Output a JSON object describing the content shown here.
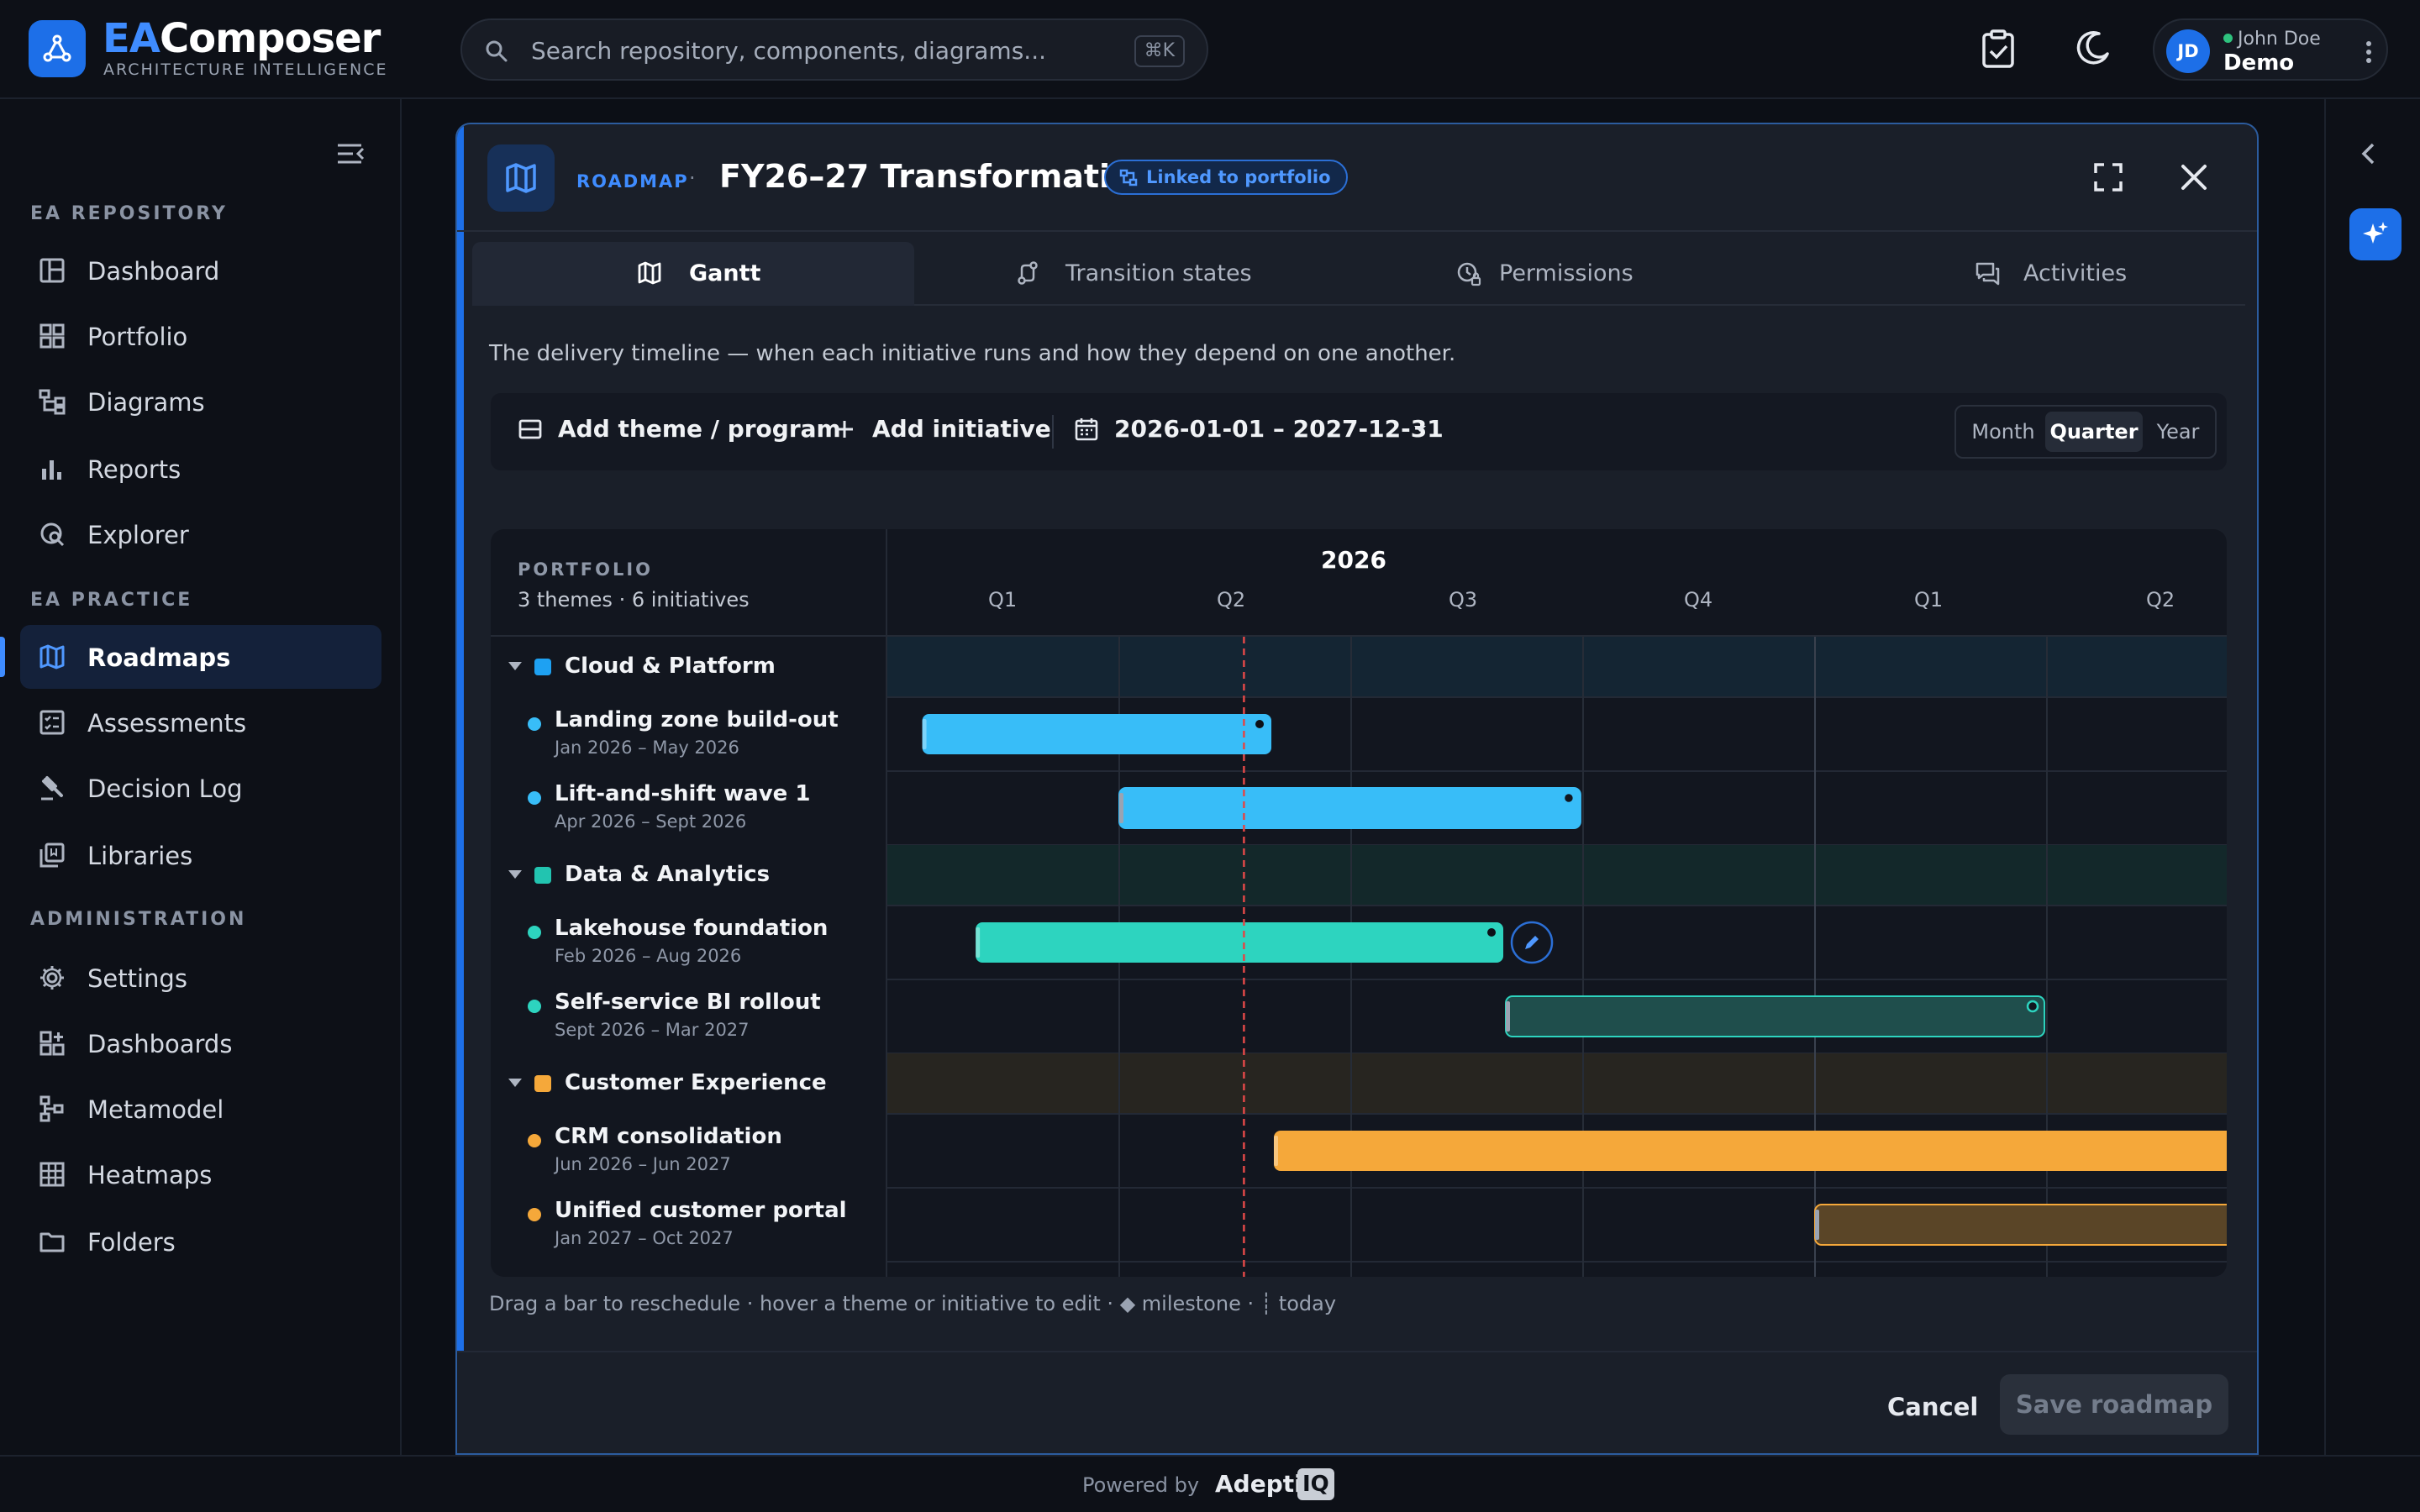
{
  "app": {
    "title_a": "EA",
    "title_b": "Composer",
    "subtitle": "ARCHITECTURE INTELLIGENCE"
  },
  "search": {
    "placeholder": "Search repository, components, diagrams...",
    "shortcut": "⌘K"
  },
  "user": {
    "initials": "JD",
    "name": "John Doe",
    "role": "Demo"
  },
  "sidebar": {
    "sections": [
      {
        "label": "EA REPOSITORY",
        "items": [
          {
            "label": "Dashboard",
            "icon": "dashboard-icon"
          },
          {
            "label": "Portfolio",
            "icon": "portfolio-icon"
          },
          {
            "label": "Diagrams",
            "icon": "diagrams-icon"
          },
          {
            "label": "Reports",
            "icon": "reports-icon"
          },
          {
            "label": "Explorer",
            "icon": "explorer-icon"
          }
        ]
      },
      {
        "label": "EA PRACTICE",
        "items": [
          {
            "label": "Roadmaps",
            "icon": "roadmaps-icon",
            "active": true
          },
          {
            "label": "Assessments",
            "icon": "assessments-icon"
          },
          {
            "label": "Decision Log",
            "icon": "gavel-icon"
          },
          {
            "label": "Libraries",
            "icon": "libraries-icon"
          }
        ]
      },
      {
        "label": "ADMINISTRATION",
        "items": [
          {
            "label": "Settings",
            "icon": "gear-icon"
          },
          {
            "label": "Dashboards",
            "icon": "dashboards-icon"
          },
          {
            "label": "Metamodel",
            "icon": "metamodel-icon"
          },
          {
            "label": "Heatmaps",
            "icon": "heatmaps-icon"
          },
          {
            "label": "Folders",
            "icon": "folder-icon"
          }
        ]
      }
    ]
  },
  "dialog": {
    "crumb": "ROADMAP",
    "separator": "·",
    "title": "FY26–27 Transformation",
    "badge": "Linked to portfolio",
    "tabs": [
      {
        "label": "Gantt",
        "active": true
      },
      {
        "label": "Transition states"
      },
      {
        "label": "Permissions"
      },
      {
        "label": "Activities"
      }
    ],
    "description": "The delivery timeline — when each initiative runs and how they depend on one another.",
    "toolbar": {
      "add_theme": "Add theme / program",
      "add_initiative": "Add initiative",
      "date_range": "2026-01-01 – 2027-12-31",
      "scale_options": [
        "Month",
        "Quarter",
        "Year"
      ],
      "scale_selected": "Quarter"
    },
    "hint": "Drag a bar to reschedule · hover a theme or initiative to edit · ◆ milestone · ┊ today",
    "cancel": "Cancel",
    "save": "Save roadmap"
  },
  "gantt": {
    "portfolio_label": "PORTFOLIO",
    "summary": "3 themes · 6 initiatives",
    "year_label": "2026",
    "quarters": [
      "Q1",
      "Q2",
      "Q3",
      "Q4",
      "Q1",
      "Q2"
    ],
    "timeline_start": "2026-01",
    "today": "2026-05-20",
    "colors": {
      "cloud": "#38bdf8",
      "data": "#2dd4bf",
      "cx": "#f5a83a"
    },
    "themes": [
      {
        "name": "Cloud & Platform",
        "color": "#1ea1f2",
        "initiatives": [
          {
            "name": "Landing zone build-out",
            "dates": "Jan 2026 – May 2026",
            "start": "2026-01-15",
            "end": "2026-05-31"
          },
          {
            "name": "Lift-and-shift wave 1",
            "dates": "Apr 2026 – Sept 2026",
            "start": "2026-04-01",
            "end": "2026-09-30"
          }
        ]
      },
      {
        "name": "Data & Analytics",
        "color": "#22c4b0",
        "initiatives": [
          {
            "name": "Lakehouse foundation",
            "dates": "Feb 2026 – Aug 2026",
            "start": "2026-02-05",
            "end": "2026-08-31"
          },
          {
            "name": "Self-service BI rollout",
            "dates": "Sept 2026 – Mar 2027",
            "start": "2026-09-01",
            "end": "2027-03-31"
          }
        ]
      },
      {
        "name": "Customer Experience",
        "color": "#f5a83a",
        "initiatives": [
          {
            "name": "CRM consolidation",
            "dates": "Jun 2026 – Jun 2027",
            "start": "2026-06-01",
            "end": "2027-06-30"
          },
          {
            "name": "Unified customer portal",
            "dates": "Jan 2027 – Oct 2027",
            "start": "2027-01-01",
            "end": "2027-10-31"
          }
        ]
      }
    ]
  },
  "footer": {
    "powered": "Powered by",
    "brand": "Adeptiv",
    "brand_badge": "IQ"
  }
}
